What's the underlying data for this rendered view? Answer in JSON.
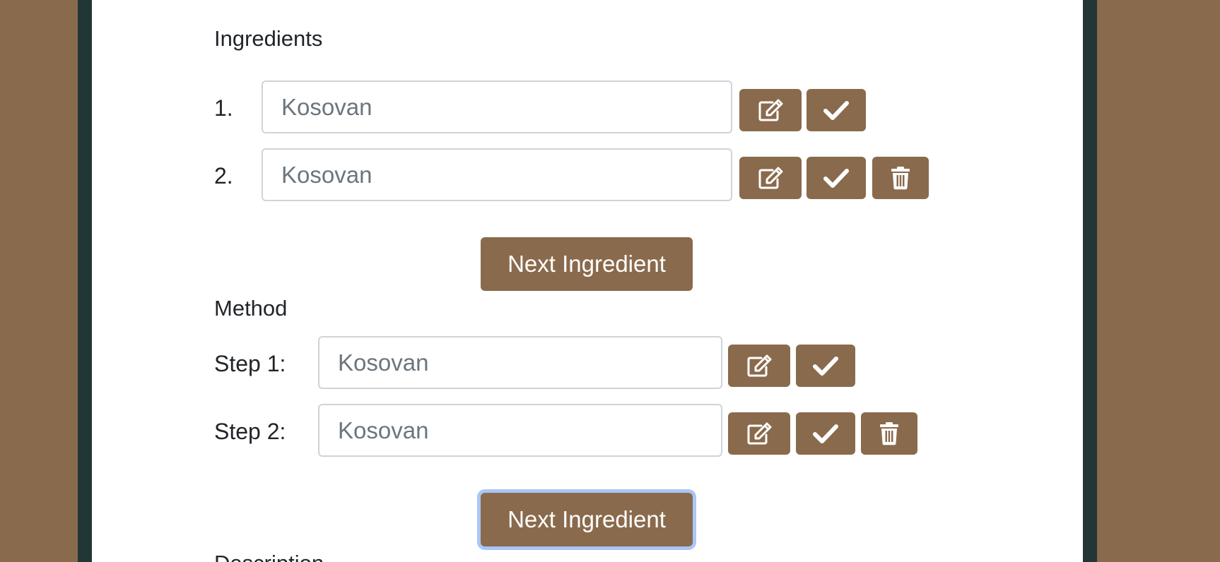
{
  "ingredients": {
    "heading": "Ingredients",
    "items": [
      {
        "number": "1.",
        "placeholder": "Kosovan"
      },
      {
        "number": "2.",
        "placeholder": "Kosovan"
      }
    ],
    "next_button": "Next Ingredient"
  },
  "method": {
    "heading": "Method",
    "steps": [
      {
        "label": "Step 1:",
        "placeholder": "Kosovan"
      },
      {
        "label": "Step 2:",
        "placeholder": "Kosovan"
      }
    ],
    "next_button": "Next Ingredient"
  },
  "description": {
    "heading": "Description"
  },
  "colors": {
    "accent": "#8a6a4c",
    "frame": "#213635",
    "focus_ring": "#a9c6f7"
  },
  "icons": {
    "edit": "edit-icon",
    "confirm": "check-icon",
    "delete": "trash-icon"
  }
}
